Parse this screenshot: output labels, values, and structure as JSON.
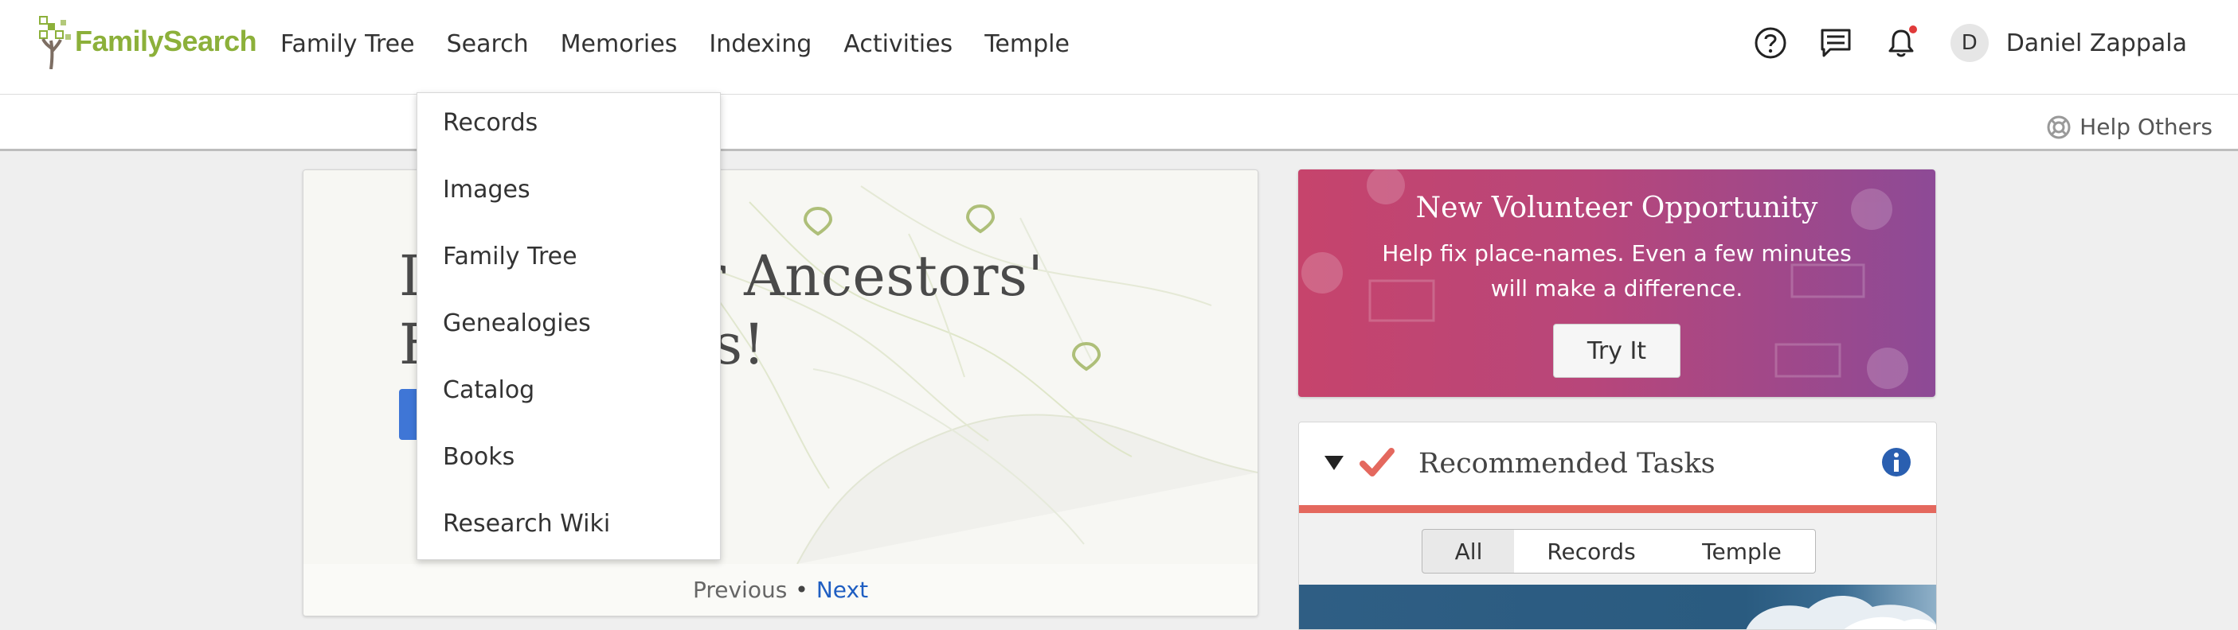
{
  "header": {
    "logo_text": "FamilySearch",
    "nav": [
      "Family Tree",
      "Search",
      "Memories",
      "Indexing",
      "Activities",
      "Temple"
    ],
    "user_initial": "D",
    "user_name": "Daniel Zappala"
  },
  "subbar": {
    "help_others": "Help Others"
  },
  "search_menu": {
    "items": [
      "Records",
      "Images",
      "Family Tree",
      "Genealogies",
      "Catalog",
      "Books",
      "Research Wiki"
    ]
  },
  "hero": {
    "title_line1": "I... our Ancestors'",
    "title_line1_left": "I",
    "title_line1_right": "our Ancestors'",
    "title_line2_left": "F",
    "title_line2_right": "s!",
    "prev": "Previous",
    "next": "Next",
    "separator": "•"
  },
  "volunteer": {
    "title": "New Volunteer Opportunity",
    "text": "Help fix place-names. Even a few minutes will make a difference.",
    "button": "Try It",
    "color_start": "#c6446c",
    "color_end": "#8d4a96"
  },
  "tasks": {
    "title": "Recommended Tasks",
    "tabs": [
      "All",
      "Records",
      "Temple"
    ],
    "active_tab": "All",
    "accent": "#e4685e"
  },
  "icons": {
    "help": "question-circle-icon",
    "messages": "chat-icon",
    "notifications": "bell-icon",
    "help_others": "lifebuoy-icon",
    "info": "info-circle-icon"
  }
}
